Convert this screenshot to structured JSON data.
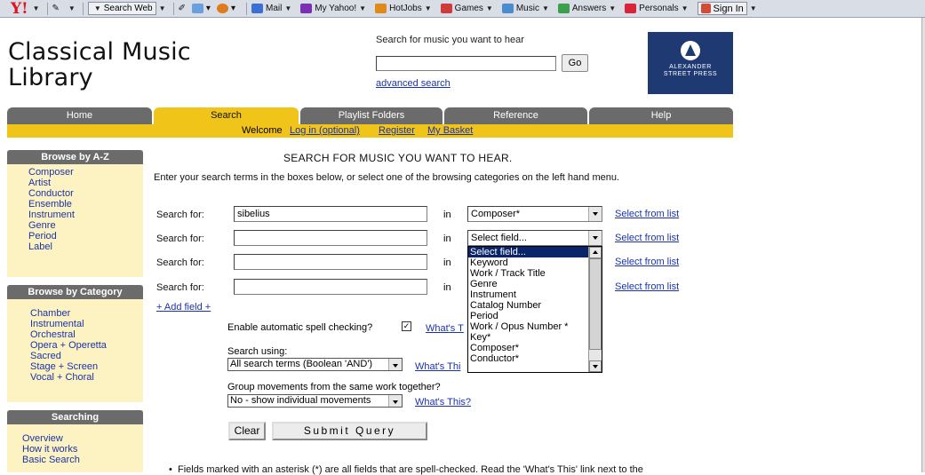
{
  "toolbar": {
    "logo": "Y!",
    "search_web": "Search Web",
    "items": [
      {
        "label": "Mail",
        "icon": "mail-icon",
        "color": "#3b6fd1"
      },
      {
        "label": "My Yahoo!",
        "icon": "my-yahoo-icon",
        "color": "#7b2fb5"
      },
      {
        "label": "HotJobs",
        "icon": "hotjobs-icon",
        "color": "#e08a1c"
      },
      {
        "label": "Games",
        "icon": "games-icon",
        "color": "#d13a3a"
      },
      {
        "label": "Music",
        "icon": "music-icon",
        "color": "#4a8ccf"
      },
      {
        "label": "Answers",
        "icon": "answers-icon",
        "color": "#3aa04a"
      },
      {
        "label": "Personals",
        "icon": "personals-icon",
        "color": "#d8253a"
      }
    ],
    "sign_in": "Sign In"
  },
  "header": {
    "title_line1": "Classical Music",
    "title_line2": "Library",
    "search_label": "Search  for music you want to hear",
    "search_value": "",
    "go_label": "Go",
    "advanced_link": "advanced search",
    "publisher_line1": "ALEXANDER",
    "publisher_line2": "STREET PRESS",
    "brand_color": "#1f3a73"
  },
  "nav": {
    "tabs": [
      "Home",
      "Search",
      "Playlist Folders",
      "Reference",
      "Help"
    ],
    "active": "Search",
    "welcome": "Welcome",
    "login": "Log in (optional)",
    "register": "Register",
    "basket": "My Basket",
    "accent_color": "#f0c419"
  },
  "sidebar": {
    "az_title": "Browse by A-Z",
    "az_items": [
      "Composer",
      "Artist",
      "Conductor",
      "Ensemble",
      "Instrument",
      "Genre",
      "Period",
      "Label"
    ],
    "category_title": "Browse by Category",
    "category_items": [
      "Chamber",
      "Instrumental",
      "Orchestral",
      "Opera + Operetta",
      "Sacred",
      "Stage + Screen",
      "Vocal + Choral"
    ],
    "searching_title": "Searching",
    "searching_items": [
      "Overview",
      "How it works",
      "Basic Search"
    ]
  },
  "main": {
    "heading": "SEARCH FOR MUSIC YOU WANT TO HEAR.",
    "intro": "Enter your search terms in the boxes below, or select one of the browsing categories on the left hand menu.",
    "rows": [
      {
        "label": "Search for:",
        "value": "sibelius",
        "in": "in",
        "field": "Composer*",
        "link": "Select from list"
      },
      {
        "label": "Search for:",
        "value": "",
        "in": "in",
        "field": "Select field...",
        "link": "Select from list"
      },
      {
        "label": "Search for:",
        "value": "",
        "in": "in",
        "field": "",
        "link": "Select from list"
      },
      {
        "label": "Search for:",
        "value": "",
        "in": "in",
        "field": "",
        "link": "Select from list"
      }
    ],
    "add_field": "+ Add field +",
    "spell_label": "Enable automatic spell checking?",
    "spell_checked": true,
    "whats_this_1": "What's T",
    "using_label": "Search using:",
    "using_value": "All search terms (Boolean 'AND')",
    "whats_this_2": "What's Thi",
    "group_label": "Group movements from the same work together?",
    "group_value": "No - show individual movements",
    "whats_this_3": "What's This?",
    "clear_label": "Clear",
    "submit_label": "Submit Query",
    "bullet": "Fields marked with an asterisk (*) are all fields that are spell-checked. Read the 'What's This' link next to the"
  },
  "dropdown": {
    "options": [
      "Select field...",
      "Keyword",
      "Work / Track Title",
      "Genre",
      "Instrument",
      "Catalog Number",
      "Period",
      "Work / Opus Number *",
      "Key*",
      "Composer*",
      "Conductor*"
    ],
    "selected": "Select field..."
  }
}
